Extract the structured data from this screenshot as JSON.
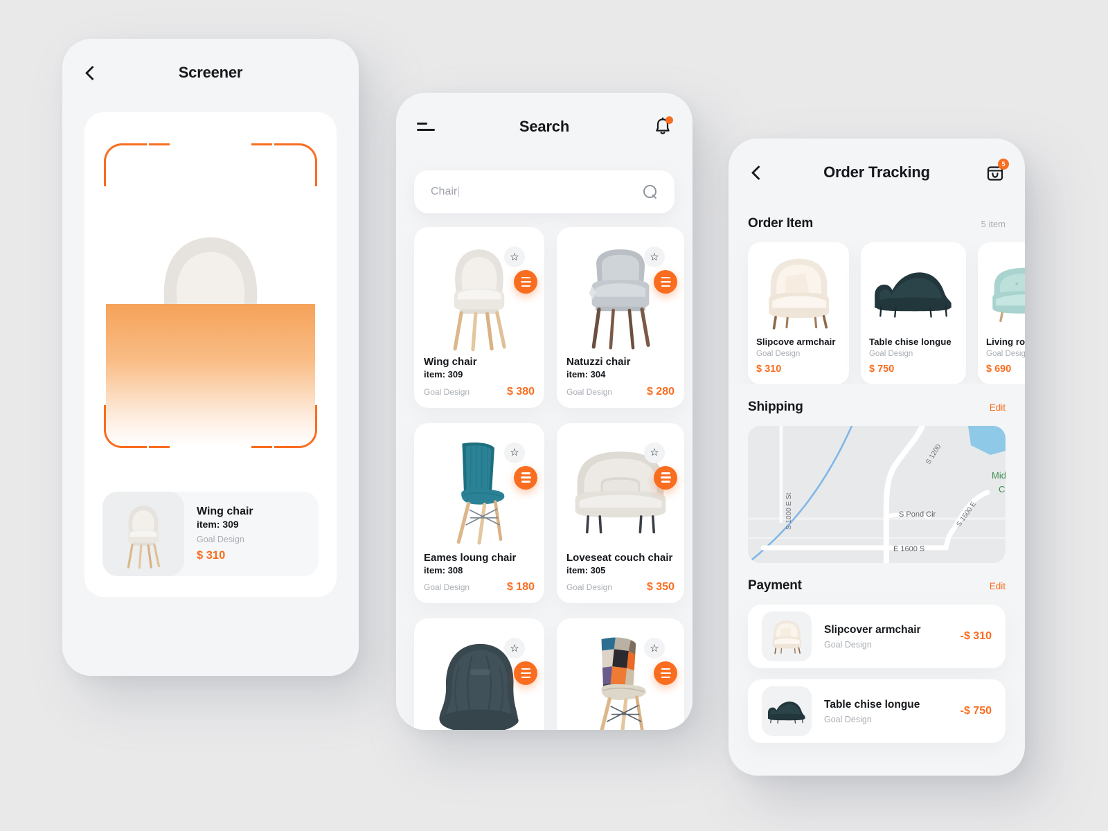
{
  "screener": {
    "header": {
      "title": "Screener",
      "back_icon": "chevron-left-icon"
    },
    "scan_overlay": "scan-frame",
    "result": {
      "name": "Wing chair",
      "item": "item: 309",
      "brand": "Goal Design",
      "price": "$ 310"
    }
  },
  "search": {
    "header": {
      "title": "Search",
      "menu_icon": "hamburger-icon",
      "bell_icon": "bell-icon",
      "bell_badge": ""
    },
    "searchbox": {
      "value": "Chair",
      "caret": "|",
      "placeholder": "Chair",
      "icon": "search-icon"
    },
    "products": [
      {
        "name": "Wing chair",
        "item": "item: 309",
        "brand": "Goal Design",
        "price": "$ 380",
        "img": "wing-chair",
        "fav": "star-icon",
        "menu": "menu-icon"
      },
      {
        "name": "Natuzzi chair",
        "item": "item: 304",
        "brand": "Goal Design",
        "price": "$ 280",
        "img": "natuzzi-chair",
        "fav": "star-icon",
        "menu": "menu-icon"
      },
      {
        "name": "Eames loung chair",
        "item": "item: 308",
        "brand": "Goal Design",
        "price": "$ 180",
        "img": "eames-chair",
        "fav": "star-icon",
        "menu": "menu-icon"
      },
      {
        "name": "Loveseat couch chair",
        "item": "item: 305",
        "brand": "Goal Design",
        "price": "$ 350",
        "img": "loveseat-couch",
        "fav": "star-icon",
        "menu": "menu-icon"
      },
      {
        "name": "",
        "item": "",
        "brand": "",
        "price": "",
        "img": "bean-bag",
        "fav": "star-icon",
        "menu": "menu-icon"
      },
      {
        "name": "",
        "item": "",
        "brand": "",
        "price": "",
        "img": "patchwork-chair",
        "fav": "star-icon",
        "menu": "menu-icon"
      }
    ]
  },
  "order": {
    "header": {
      "title": "Order Tracking",
      "back_icon": "chevron-left-icon",
      "cart_icon": "cart-icon",
      "cart_badge": "5"
    },
    "order_item": {
      "title": "Order Item",
      "count": "5 item",
      "items": [
        {
          "name": "Slipcove armchair",
          "brand": "Goal Design",
          "price": "$ 310",
          "img": "cream-armchair"
        },
        {
          "name": "Table chise longue",
          "brand": "Goal Design",
          "price": "$ 750",
          "img": "dark-chaise"
        },
        {
          "name": "Living room sofa",
          "brand": "Goal Design",
          "price": "$ 690",
          "img": "mint-sofa"
        }
      ]
    },
    "shipping": {
      "title": "Shipping",
      "edit": "Edit",
      "map_labels": [
        "S 1000 E St",
        "S Pond Cir",
        "E 1600 S",
        "S 1200",
        "S 1500 E",
        "Mid",
        "C"
      ]
    },
    "payment": {
      "title": "Payment",
      "edit": "Edit",
      "rows": [
        {
          "name": "Slipcover armchair",
          "brand": "Goal Design",
          "amount": "-$ 310",
          "img": "cream-armchair"
        },
        {
          "name": "Table chise longue",
          "brand": "Goal Design",
          "amount": "-$ 750",
          "img": "dark-chaise"
        }
      ]
    }
  },
  "colors": {
    "accent": "#f96d20",
    "background": "#e9e9ea",
    "phone_bg": "#f4f5f6",
    "card_bg": "#ffffff",
    "text": "#15181c",
    "muted": "#a9aeb4"
  }
}
